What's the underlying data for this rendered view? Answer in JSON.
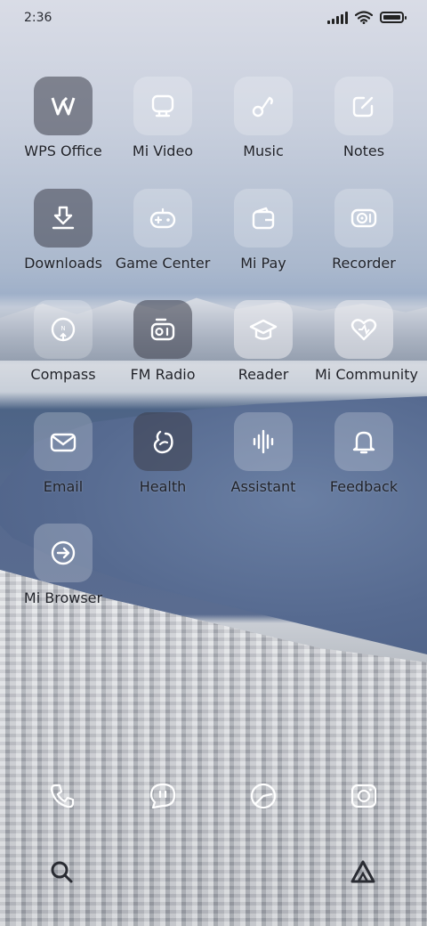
{
  "status_bar": {
    "time": "2:36"
  },
  "apps": [
    {
      "label": "WPS Office",
      "icon": "wps-office-icon"
    },
    {
      "label": "Mi Video",
      "icon": "tv-icon"
    },
    {
      "label": "Music",
      "icon": "music-note-icon"
    },
    {
      "label": "Notes",
      "icon": "note-pencil-icon"
    },
    {
      "label": "Downloads",
      "icon": "download-icon"
    },
    {
      "label": "Game Center",
      "icon": "gamepad-icon"
    },
    {
      "label": "Mi Pay",
      "icon": "wallet-icon"
    },
    {
      "label": "Recorder",
      "icon": "recorder-icon"
    },
    {
      "label": "Compass",
      "icon": "compass-icon"
    },
    {
      "label": "FM Radio",
      "icon": "radio-icon"
    },
    {
      "label": "Reader",
      "icon": "graduation-cap-icon"
    },
    {
      "label": "Mi Community",
      "icon": "heart-icon"
    },
    {
      "label": "Email",
      "icon": "envelope-icon"
    },
    {
      "label": "Health",
      "icon": "health-icon"
    },
    {
      "label": "Assistant",
      "icon": "soundwave-icon"
    },
    {
      "label": "Feedback",
      "icon": "bell-icon"
    },
    {
      "label": "Mi Browser",
      "icon": "browser-arrow-icon"
    }
  ],
  "dock": [
    "phone-icon",
    "messages-icon",
    "clock-icon",
    "camera-icon"
  ],
  "bottom": [
    "search-icon",
    "assistant-triangle-icon"
  ]
}
